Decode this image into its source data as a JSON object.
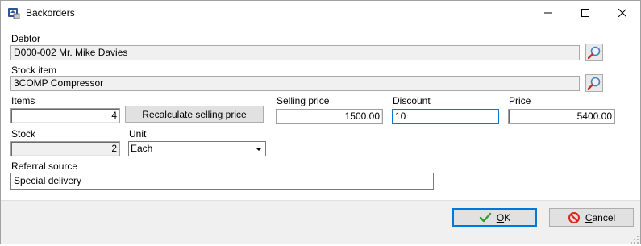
{
  "window": {
    "title": "Backorders",
    "icon": "backorders-app-icon",
    "controls": [
      "minimize-icon",
      "maximize-icon",
      "close-icon"
    ]
  },
  "form": {
    "debtor": {
      "label": "Debtor",
      "value": "D000-002 Mr. Mike Davies"
    },
    "stock_item": {
      "label": "Stock item",
      "value": "3COMP Compressor"
    },
    "items": {
      "label": "Items",
      "value": "4"
    },
    "recalculate_label": "Recalculate selling price",
    "selling_price": {
      "label": "Selling price",
      "value": "1500.00"
    },
    "discount": {
      "label": "Discount",
      "value": "10"
    },
    "price": {
      "label": "Price",
      "value": "5400.00"
    },
    "stock": {
      "label": "Stock",
      "value": "2"
    },
    "unit": {
      "label": "Unit",
      "value": "Each"
    },
    "referral_source": {
      "label": "Referral source",
      "value": "Special delivery"
    }
  },
  "buttons": {
    "ok_label_mnemonic": "O",
    "ok_label_rest": "K",
    "cancel_label_mnemonic": "C",
    "cancel_label_rest": "ancel"
  },
  "colors": {
    "ok_check": "#2e9e2e",
    "cancel_icon": "#d9261c",
    "focus_border": "#0078d7"
  }
}
